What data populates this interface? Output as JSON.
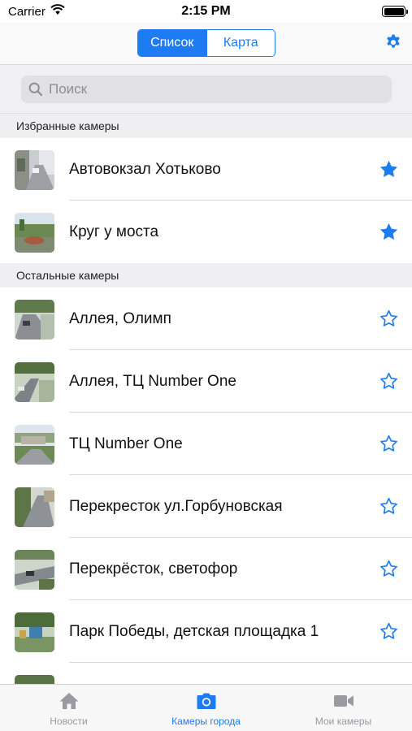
{
  "status_bar": {
    "carrier": "Carrier",
    "time": "2:15 PM"
  },
  "nav": {
    "segments": [
      "Список",
      "Карта"
    ],
    "active_segment": 0
  },
  "search": {
    "placeholder": "Поиск",
    "value": ""
  },
  "favorites": {
    "header": "Избранные камеры",
    "items": [
      {
        "label": "Автовокзал Хотьково",
        "favorite": true
      },
      {
        "label": "Круг у моста",
        "favorite": true
      }
    ]
  },
  "others": {
    "header": "Остальные камеры",
    "items": [
      {
        "label": "Аллея, Олимп",
        "favorite": false
      },
      {
        "label": "Аллея, ТЦ Number One",
        "favorite": false
      },
      {
        "label": "ТЦ Number One",
        "favorite": false
      },
      {
        "label": "Перекресток ул.Горбуновская",
        "favorite": false
      },
      {
        "label": "Перекрёсток, светофор",
        "favorite": false
      },
      {
        "label": "Парк Победы, детская площадка 1",
        "favorite": false
      }
    ]
  },
  "tabs": [
    {
      "label": "Новости",
      "icon": "house-icon",
      "active": false
    },
    {
      "label": "Камеры города",
      "icon": "camera-icon",
      "active": true
    },
    {
      "label": "Мои камеры",
      "icon": "video-camera-icon",
      "active": false
    }
  ],
  "colors": {
    "accent": "#1e7cf2",
    "inactive_tab": "#9a9aa0",
    "section_bg": "#efeff2"
  }
}
